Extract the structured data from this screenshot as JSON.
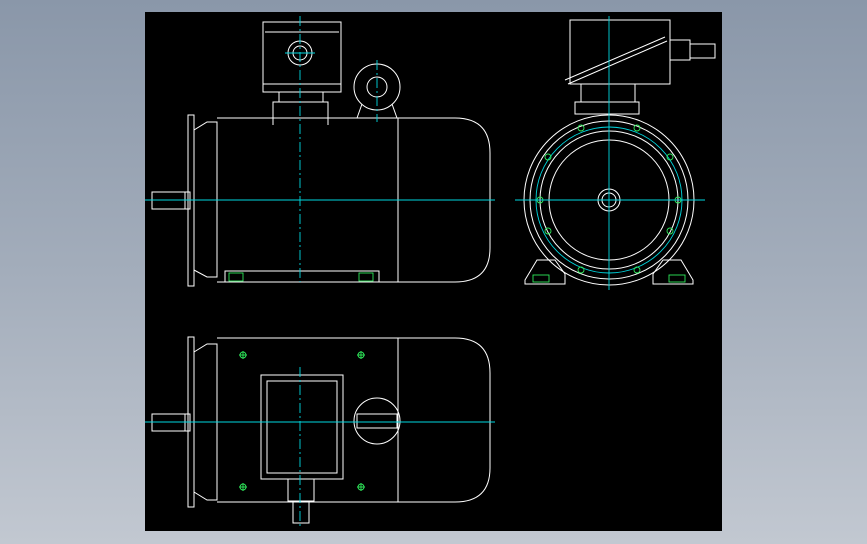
{
  "drawing": {
    "background_color": "#000000",
    "line_color": "#ffffff",
    "centerline_color": "#00d8e0",
    "hole_color": "#2ee85a"
  },
  "views": [
    {
      "name": "front-view"
    },
    {
      "name": "end-view"
    },
    {
      "name": "top-view"
    }
  ]
}
